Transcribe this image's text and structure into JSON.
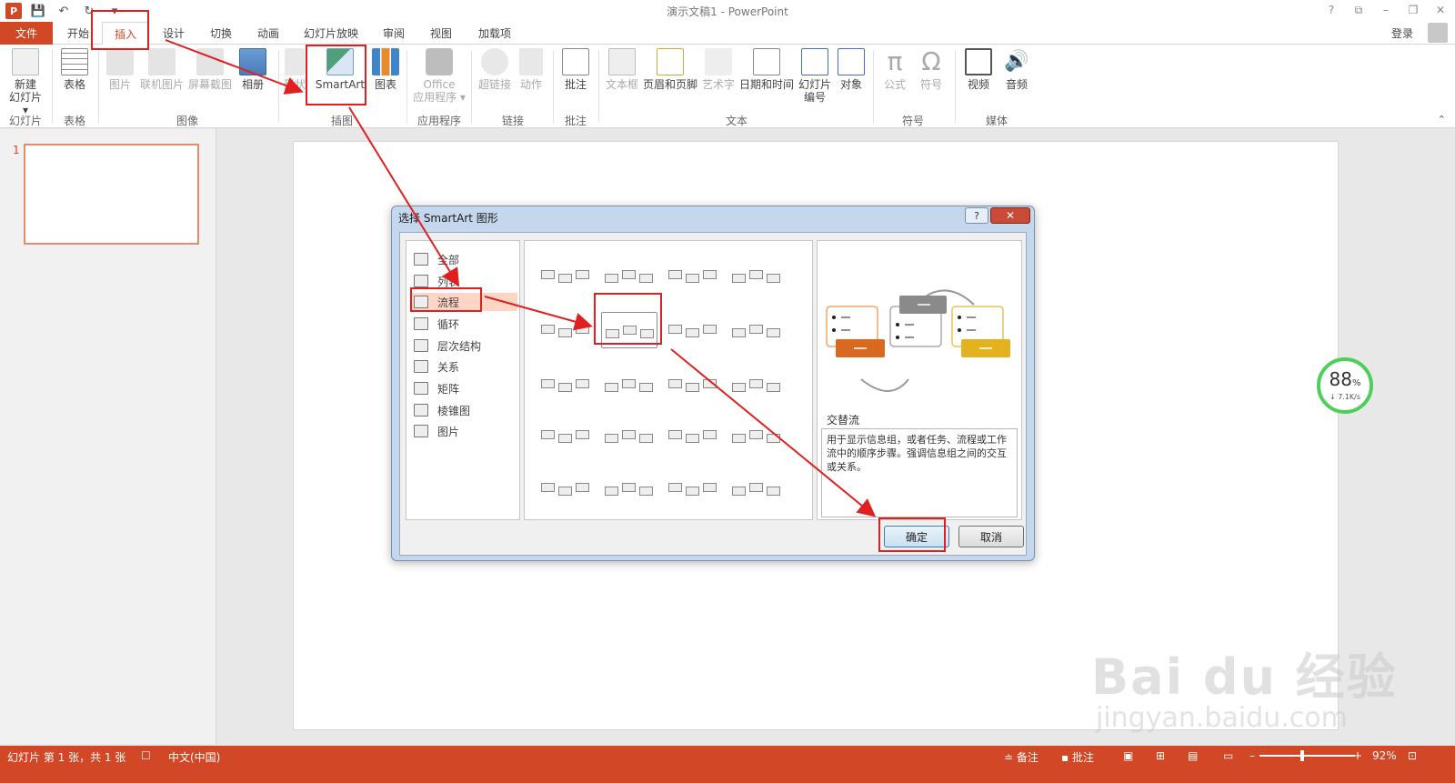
{
  "window": {
    "title": "演示文稿1 - PowerPoint"
  },
  "qat": {
    "logo": "P",
    "save": "💾",
    "undo": "↶",
    "redo": "↻",
    "customize": "▾"
  },
  "win_controls": {
    "help": "?",
    "ribbon_opts": "⧉",
    "minimize": "–",
    "restore": "❐",
    "close": "✕"
  },
  "tabs": {
    "file": "文件",
    "items": [
      "开始",
      "插入",
      "设计",
      "切换",
      "动画",
      "幻灯片放映",
      "审阅",
      "视图",
      "加载项"
    ],
    "login": "登录"
  },
  "ribbon": {
    "new_slide": "新建\n幻灯片 ▾",
    "table": "表格",
    "picture": "图片",
    "online_picture": "联机图片",
    "screenshot": "屏幕截图",
    "album": "相册",
    "shapes": "形状",
    "smartart": "SmartArt",
    "chart": "图表",
    "office_apps": "Office\n应用程序 ▾",
    "hyperlink": "超链接",
    "action": "动作",
    "comment": "批注",
    "textbox": "文本框",
    "header_footer": "页眉和页脚",
    "wordart": "艺术字",
    "datetime": "日期和时间",
    "slide_number": "幻灯片\n编号",
    "object": "对象",
    "equation": "公式",
    "symbol": "符号",
    "video": "视频",
    "audio": "音频",
    "groups": {
      "slides": "幻灯片",
      "tables": "表格",
      "images": "图像",
      "illustrations": "插图",
      "apps": "应用程序",
      "links": "链接",
      "comments": "批注",
      "text": "文本",
      "symbols": "符号",
      "media": "媒体"
    }
  },
  "slidepane": {
    "num": "1"
  },
  "dialog": {
    "title": "选择 SmartArt 图形",
    "help": "?",
    "close": "✕",
    "categories": [
      "全部",
      "列表",
      "流程",
      "循环",
      "层次结构",
      "关系",
      "矩阵",
      "棱锥图",
      "图片"
    ],
    "selected_category": "流程",
    "preview_title": "交替流",
    "preview_desc": "用于显示信息组，或者任务、流程或工作流中的顺序步骤。强调信息组之间的交互或关系。",
    "ok": "确定",
    "cancel": "取消"
  },
  "speed": {
    "percent": "88",
    "percent_unit": "%",
    "rate": "↓ 7.1K/s"
  },
  "watermark": {
    "main": "Bai du 经验",
    "sub": "jingyan.baidu.com"
  },
  "status": {
    "slide_info": "幻灯片 第 1 张，共 1 张",
    "language": "中文(中国)",
    "notes": "≐ 备注",
    "comments": "批注",
    "zoom": "92%"
  },
  "colors": {
    "accent": "#d24726",
    "annotation": "#e02020",
    "speed_ring": "#4cd05a"
  }
}
